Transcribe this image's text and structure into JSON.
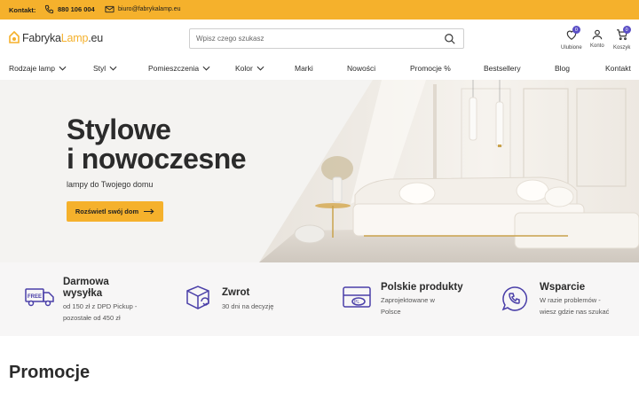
{
  "topbar": {
    "contact_label": "Kontakt:",
    "phone": "880 106 004",
    "email": "biuro@fabrykalamp.eu",
    "background": "#f5b12c"
  },
  "header": {
    "logo_part1": "Fabryka",
    "logo_part2": "Lamp",
    "logo_part3": ".eu",
    "search_placeholder": "Wpisz czego szukasz",
    "favorites_label": "Ulubione",
    "favorites_count": "0",
    "account_label": "Konto",
    "cart_label": "Koszyk",
    "cart_count": "0"
  },
  "nav": {
    "items": [
      {
        "label": "Rodzaje lamp",
        "dropdown": true
      },
      {
        "label": "Styl",
        "dropdown": true
      },
      {
        "label": "Pomieszczenia",
        "dropdown": true
      },
      {
        "label": "Kolor",
        "dropdown": true
      },
      {
        "label": "Marki",
        "dropdown": false
      },
      {
        "label": "Nowości",
        "dropdown": false
      },
      {
        "label": "Promocje %",
        "dropdown": false
      },
      {
        "label": "Bestsellery",
        "dropdown": false
      },
      {
        "label": "Blog",
        "dropdown": false
      },
      {
        "label": "Kontakt",
        "dropdown": false
      }
    ]
  },
  "hero": {
    "title_line1": "Stylowe",
    "title_line2": "i nowoczesne",
    "subtitle": "lampy do Twojego domu",
    "cta_label": "Rozświetl swój dom"
  },
  "benefits": [
    {
      "icon": "free-delivery-truck-icon",
      "title_line1": "Darmowa",
      "title_line2": "wysyłka",
      "desc_line1": "od 150 zł z DPD Pickup -",
      "desc_line2": "pozostałe od 450 zł",
      "truck_text": "FREE"
    },
    {
      "icon": "return-box-icon",
      "title_line1": "Zwrot",
      "title_line2": "",
      "desc_line1": "30 dni na decyzję",
      "desc_line2": ""
    },
    {
      "icon": "polish-product-icon",
      "title_line1": "Polskie produkty",
      "title_line2": "",
      "desc_line1": "Zaprojektowane w",
      "desc_line2": "Polsce",
      "flag_text": "PL"
    },
    {
      "icon": "support-phone-icon",
      "title_line1": "Wsparcie",
      "title_line2": "",
      "desc_line1": "W razie problemów -",
      "desc_line2": "wiesz gdzie nas szukać"
    }
  ],
  "sections": {
    "promo_title": "Promocje"
  },
  "colors": {
    "accent": "#f5b12c",
    "badge": "#5b4fc6",
    "icon_purple": "#4a3fa8"
  }
}
